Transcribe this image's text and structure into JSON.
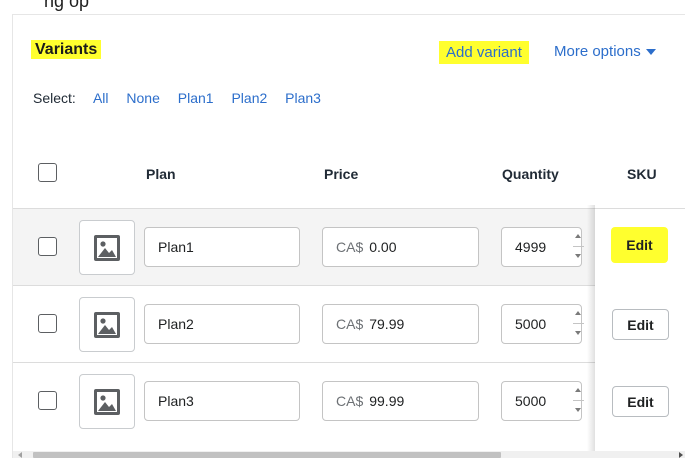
{
  "card": {
    "title": "Variants",
    "add_variant_label": "Add variant",
    "more_options_label": "More options"
  },
  "select": {
    "label": "Select:",
    "options": [
      "All",
      "None",
      "Plan1",
      "Plan2",
      "Plan3"
    ]
  },
  "table": {
    "headers": {
      "plan": "Plan",
      "price": "Price",
      "quantity": "Quantity",
      "sku": "SKU"
    },
    "rows": [
      {
        "plan": "Plan1",
        "price_prefix": "CA$",
        "price": "0.00",
        "quantity": "4999",
        "edit_label": "Edit",
        "highlighted": true
      },
      {
        "plan": "Plan2",
        "price_prefix": "CA$",
        "price": "79.99",
        "quantity": "5000",
        "edit_label": "Edit",
        "highlighted": false
      },
      {
        "plan": "Plan3",
        "price_prefix": "CA$",
        "price": "99.99",
        "quantity": "5000",
        "edit_label": "Edit",
        "highlighted": false
      }
    ]
  },
  "icons": {
    "image_placeholder": "image-icon",
    "dropdown": "caret-down-icon"
  },
  "colors": {
    "link": "#2c6ecb",
    "highlight": "#ffff2e",
    "row_hover": "#f4f4f4"
  }
}
